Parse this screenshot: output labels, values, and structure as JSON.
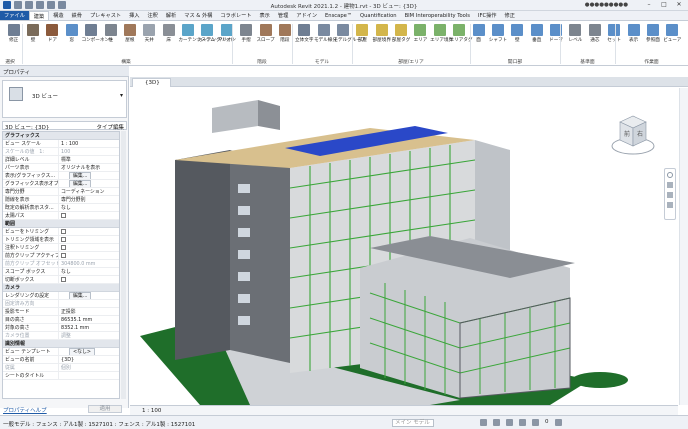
{
  "window": {
    "title": "Autodesk Revit 2021.1.2 - 建物1.rvt - 3D ビュー: {3D}",
    "user": "●●●●●●●●●"
  },
  "tabs": [
    "ファイル",
    "建築",
    "構造",
    "鉄骨",
    "プレキャスト",
    "挿入",
    "注釈",
    "解析",
    "マス & 外構",
    "コラボレート",
    "表示",
    "管理",
    "アドイン",
    "Enscape™",
    "Quantification",
    "BIM Interoperability Tools",
    "IFC操作",
    "修正"
  ],
  "ribbon": {
    "buttons": [
      "修正",
      "壁",
      "ドア",
      "窓",
      "コンポーネント",
      "柱",
      "屋根",
      "天井",
      "床",
      "カーテンシステム",
      "カーテングリッド",
      "マリオン",
      "手摺",
      "スロープ",
      "階段",
      "立体文字",
      "モデル線分",
      "モデルグループ",
      "部屋",
      "部屋境界",
      "部屋タグ",
      "エリア",
      "エリア境界",
      "エリアタグ",
      "面",
      "シャフト",
      "壁",
      "垂直",
      "ドーマ",
      "レベル",
      "通芯",
      "セット",
      "表示",
      "参照面",
      "ビューア"
    ],
    "groups": [
      "選択",
      "構築",
      "階段",
      "モデル",
      "部屋/エリア",
      "開口部",
      "基準面",
      "作業面"
    ]
  },
  "properties": {
    "title": "プロパティ",
    "type": "3D ビュー",
    "instance": "3D ビュー: {3D}",
    "edit_type": "タイプ編集",
    "sections": [
      {
        "name": "グラフィックス",
        "rows": [
          [
            "ビュー スケール",
            "1 : 100",
            ""
          ],
          [
            "スケールの値　1:",
            "100",
            "dim"
          ],
          [
            "詳細レベル",
            "標準",
            ""
          ],
          [
            "パーツ表示",
            "オリジナルを表示",
            ""
          ],
          [
            "表示/グラフィックス...",
            "編集...",
            "btn"
          ],
          [
            "グラフィックス表示オプ...",
            "編集...",
            "btn"
          ],
          [
            "専門分野",
            "コーディネーション",
            ""
          ],
          [
            "隠線を表示",
            "専門分野別",
            ""
          ],
          [
            "既定の解析表示スタ...",
            "なし",
            ""
          ],
          [
            "太陽パス",
            "",
            "cb"
          ]
        ]
      },
      {
        "name": "範囲",
        "rows": [
          [
            "ビューをトリミング",
            "",
            "cb"
          ],
          [
            "トリミング領域を表示",
            "",
            "cb"
          ],
          [
            "注釈トリミング",
            "",
            "cb"
          ],
          [
            "前方クリップ アクティブ",
            "",
            "cb"
          ],
          [
            "前方クリップ オフセット",
            "304800.0 mm",
            "dim"
          ],
          [
            "スコープ ボックス",
            "なし",
            ""
          ],
          [
            "切断ボックス",
            "",
            "cb"
          ]
        ]
      },
      {
        "name": "カメラ",
        "rows": [
          [
            "レンダリングの設定",
            "編集...",
            "btn"
          ],
          [
            "固定済み方向",
            "",
            "dim"
          ],
          [
            "投影モード",
            "正投影",
            ""
          ],
          [
            "目の高さ",
            "86535.1 mm",
            ""
          ],
          [
            "対象の高さ",
            "8352.1 mm",
            ""
          ],
          [
            "カメラ位置",
            "調整",
            "dim"
          ]
        ]
      },
      {
        "name": "識別情報",
        "rows": [
          [
            "ビュー テンプレート",
            "<なし>",
            "btn"
          ],
          [
            "ビューの名前",
            "{3D}",
            ""
          ],
          [
            "従属",
            "個別",
            "dim"
          ],
          [
            "シートのタイトル",
            "",
            ""
          ]
        ]
      }
    ],
    "help": "プロパティヘルプ",
    "apply": "適用"
  },
  "view": {
    "tab": "{3D}",
    "scale": "1 : 100",
    "cube_face": "前",
    "cube_face2": "右"
  },
  "status": {
    "text": "一般モデル : フェンス : アル1製 : 1527101 : フェンス : アル1製 : 1527101",
    "workset": "メイン モデル",
    "filter_count": "0"
  },
  "colors": {
    "accent": "#1f5ba7",
    "glass_green": "#3ba63a",
    "roof_blue": "#2a48c8",
    "concrete": "#6b6f75",
    "ground": "#1f6e2a"
  }
}
